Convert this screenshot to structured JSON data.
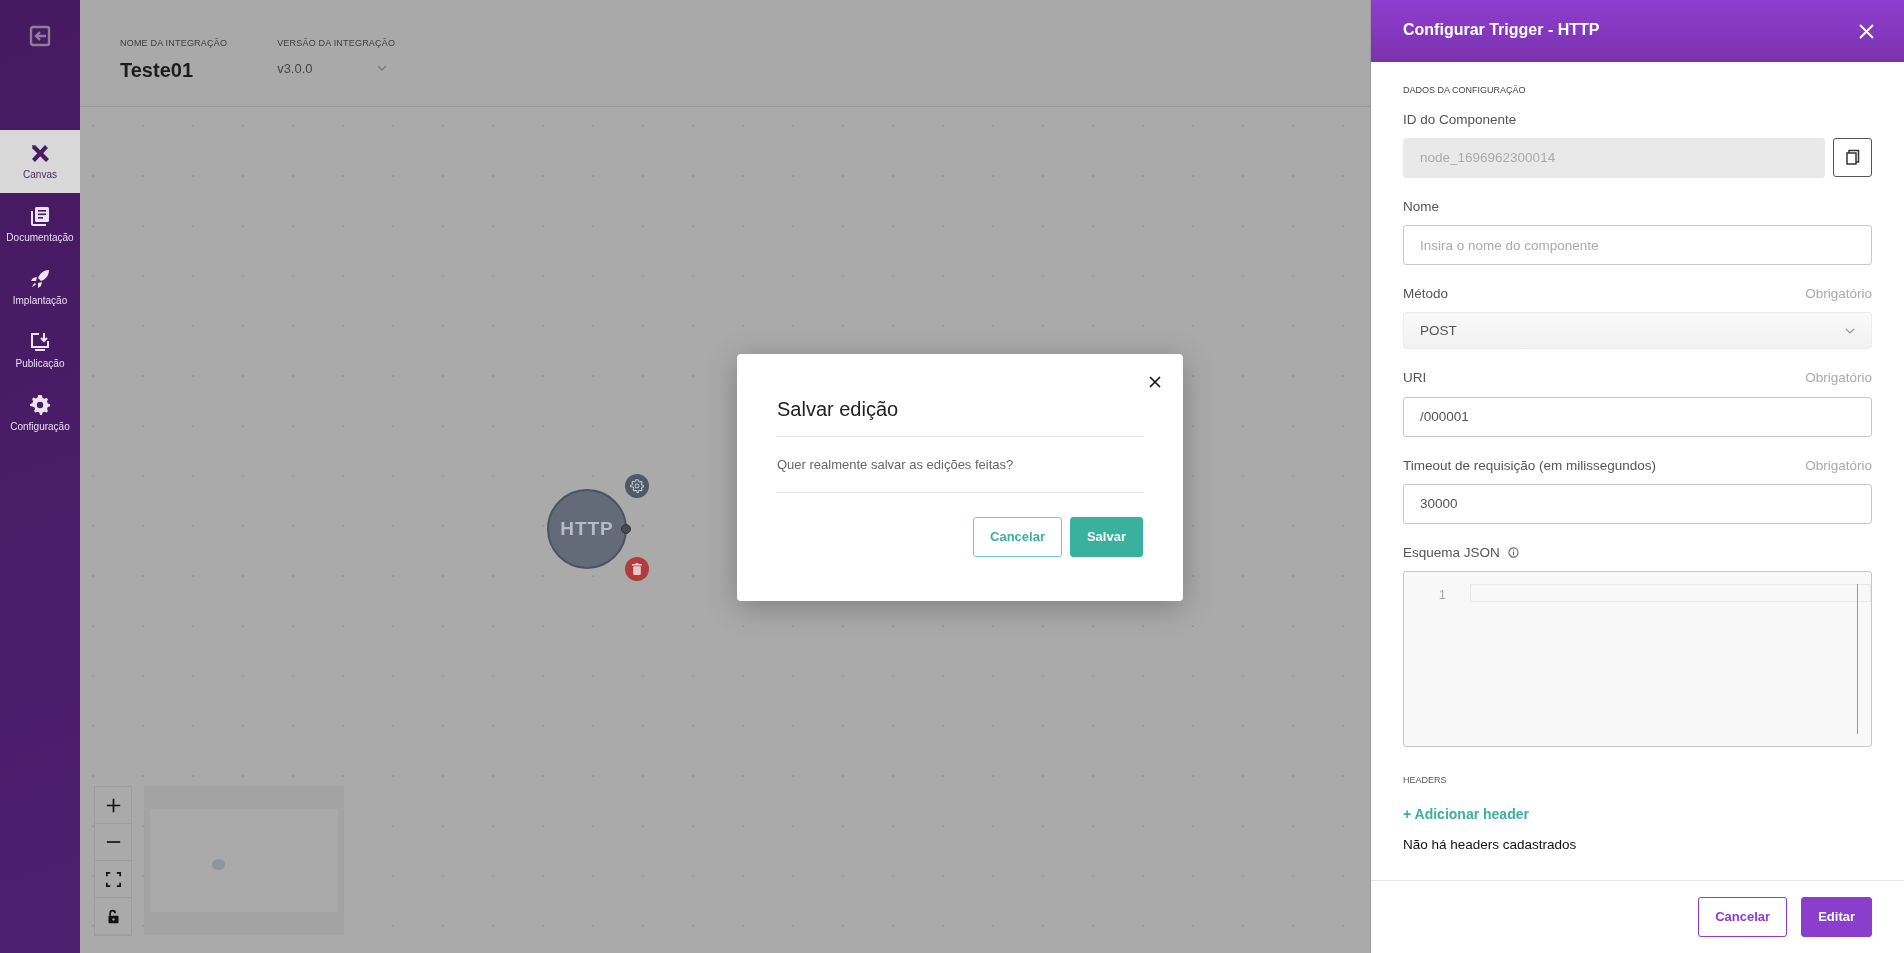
{
  "sidebar": {
    "items": [
      {
        "label": "Canvas",
        "selected": true
      },
      {
        "label": "Documentação",
        "selected": false
      },
      {
        "label": "Implantação",
        "selected": false
      },
      {
        "label": "Publicação",
        "selected": false
      },
      {
        "label": "Configuração",
        "selected": false
      }
    ]
  },
  "header": {
    "name_label": "NOME DA INTEGRAÇÃO",
    "name": "Teste01",
    "version_label": "VERSÃO DA INTEGRAÇÃO",
    "version": "v3.0.0"
  },
  "canvas": {
    "nodes": [
      {
        "label": "HTTP"
      }
    ]
  },
  "modal": {
    "title": "Salvar edição",
    "message": "Quer realmente salvar as edições feitas?",
    "buttons": [
      {
        "label": "Cancelar",
        "kind": "outline"
      },
      {
        "label": "Salvar",
        "kind": "primary"
      }
    ]
  },
  "panel": {
    "title": "Configurar Trigger - HTTP",
    "section": "DADOS DA CONFIGURAÇÃO",
    "fields": [
      {
        "kind": "readonly",
        "label": "ID do Componente",
        "value": "node_1696962300014"
      },
      {
        "kind": "text",
        "label": "Nome",
        "placeholder": "Insira o nome do componente"
      },
      {
        "kind": "select",
        "label": "Método",
        "required": "Obrigatório",
        "value": "POST"
      },
      {
        "kind": "text",
        "label": "URI",
        "required": "Obrigatório",
        "value": "/000001"
      },
      {
        "kind": "text",
        "label": "Timeout de requisição (em milissegundos)",
        "required": "Obrigatório",
        "value": "30000"
      },
      {
        "kind": "code",
        "label": "Esquema JSON",
        "line_numbers": [
          "1"
        ]
      }
    ],
    "headers_title": "HEADERS",
    "add_header": "+ Adicionar header",
    "empty_text": "Não há headers cadastrados",
    "buttons": [
      {
        "label": "Cancelar",
        "kind": "outline"
      },
      {
        "label": "Editar",
        "kind": "primary"
      }
    ]
  }
}
